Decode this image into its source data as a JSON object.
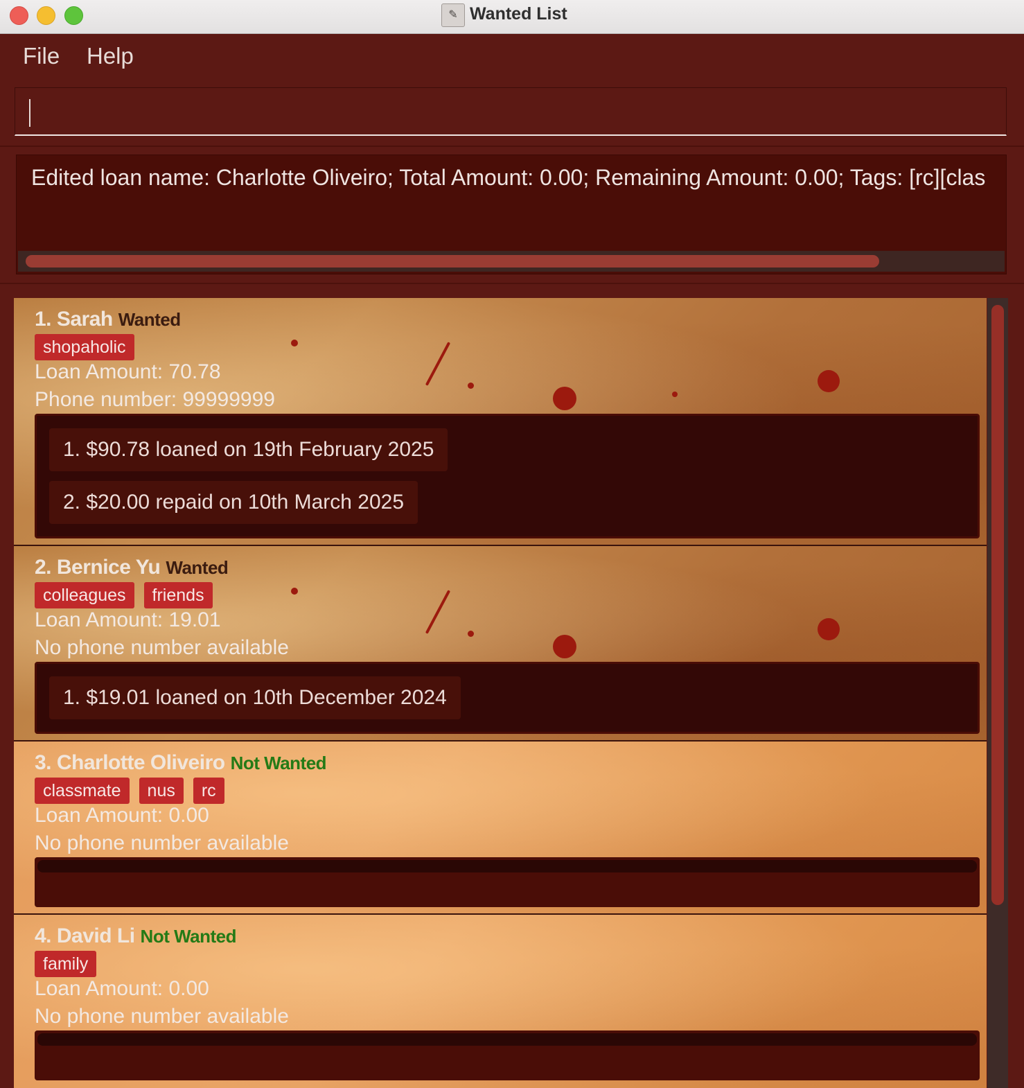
{
  "window": {
    "title": "Wanted List",
    "app_icon": "wanted-list-app-icon"
  },
  "menu": {
    "file_label": "File",
    "help_label": "Help"
  },
  "command_box": {
    "value": ""
  },
  "result_display": {
    "text": "Edited loan name: Charlotte Oliveiro; Total Amount: 0.00; Remaining Amount: 0.00; Tags: [rc][clas"
  },
  "colors": {
    "background": "#5c1914",
    "tag": "#c0292a",
    "wanted_status": "#3b1c10",
    "not_wanted_status": "#247a16"
  },
  "cards": [
    {
      "name": "1. Sarah",
      "status": "Wanted",
      "tags": [
        "shopaholic"
      ],
      "loan_amount": "Loan Amount: 70.78",
      "phone": "Phone number: 99999999",
      "transactions": [
        "1. $90.78 loaned on 19th February 2025",
        "2. $20.00 repaid on 10th March 2025"
      ]
    },
    {
      "name": "2. Bernice Yu",
      "status": "Wanted",
      "tags": [
        "colleagues",
        "friends"
      ],
      "loan_amount": "Loan Amount: 19.01",
      "phone": "No phone number available",
      "transactions": [
        "1. $19.01 loaned on 10th December 2024"
      ]
    },
    {
      "name": "3. Charlotte Oliveiro",
      "status": "Not Wanted",
      "tags": [
        "classmate",
        "nus",
        "rc"
      ],
      "loan_amount": "Loan Amount: 0.00",
      "phone": "No phone number available",
      "transactions": []
    },
    {
      "name": "4. David Li",
      "status": "Not Wanted",
      "tags": [
        "family"
      ],
      "loan_amount": "Loan Amount: 0.00",
      "phone": "No phone number available",
      "transactions": []
    }
  ]
}
